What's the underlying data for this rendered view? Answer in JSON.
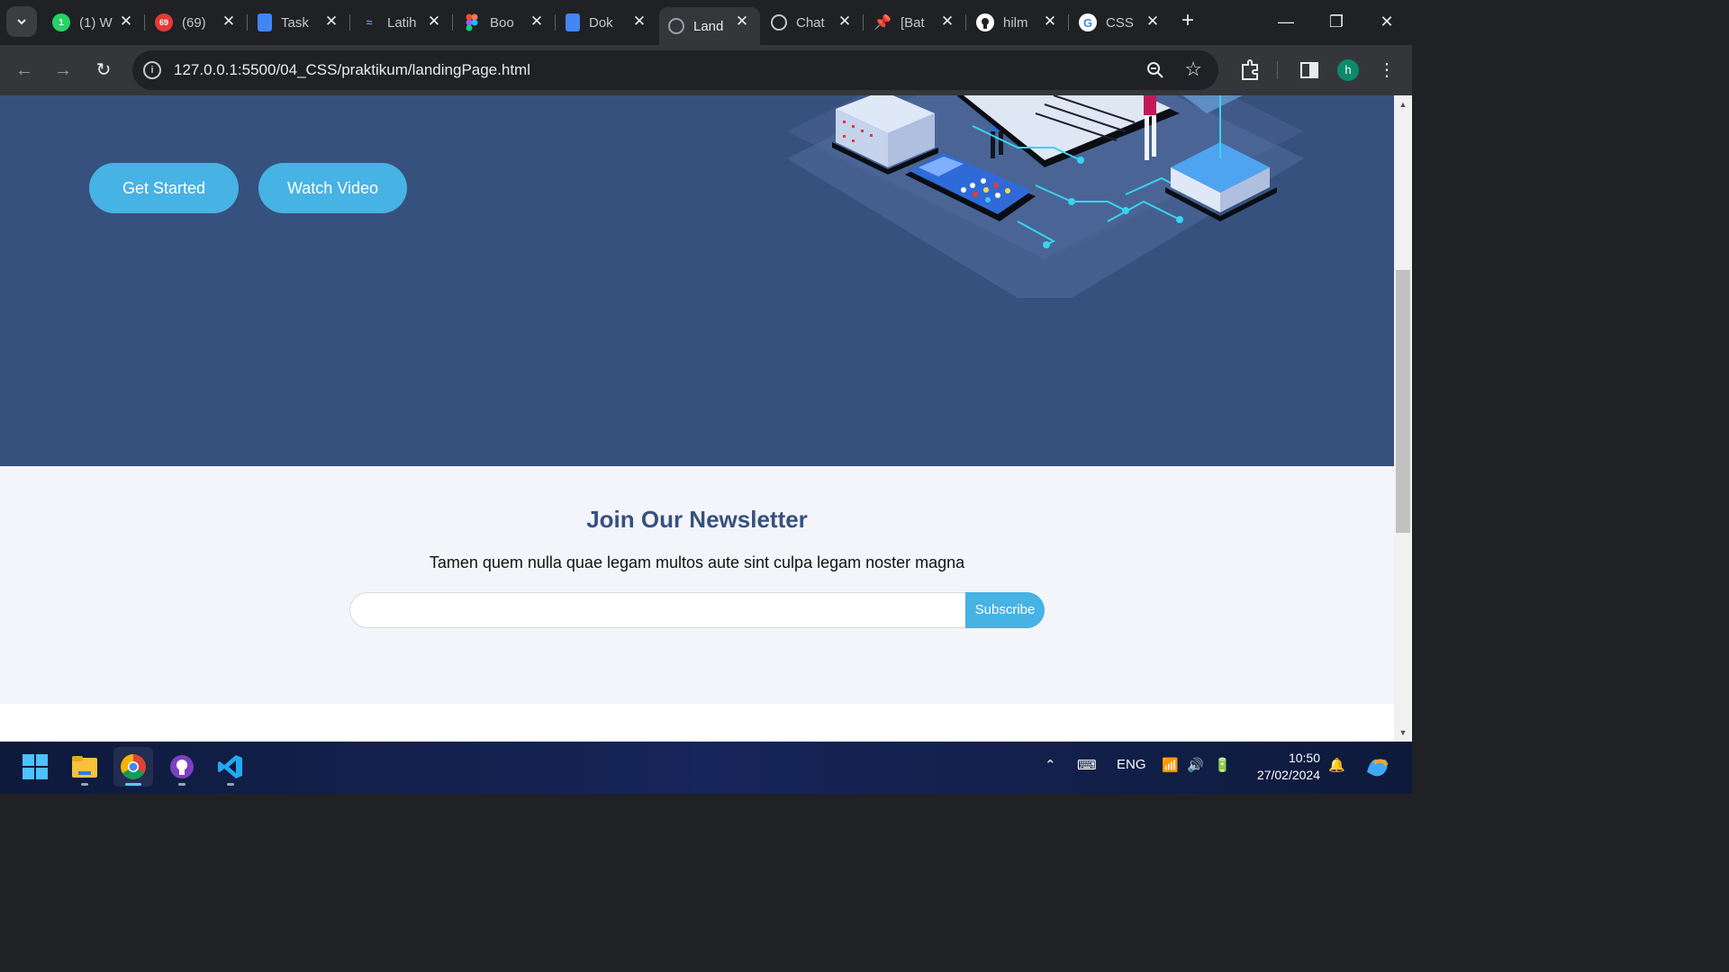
{
  "browser": {
    "tabs": [
      {
        "title": "(1) W",
        "icon": "whatsapp-icon",
        "badge": "1",
        "color": "#25d366"
      },
      {
        "title": "(69)",
        "icon": "chrome-badge-icon",
        "badge": "69",
        "color": "#e53935"
      },
      {
        "title": "Task",
        "icon": "docs-icon",
        "color": "#4285f4"
      },
      {
        "title": "Latih",
        "icon": "latih-icon",
        "color": "#3b5bdb"
      },
      {
        "title": "Boo",
        "icon": "figma-icon",
        "color": "#f24e1e"
      },
      {
        "title": "Dok",
        "icon": "docs-icon",
        "color": "#4285f4"
      },
      {
        "title": "Land",
        "icon": "globe-icon",
        "color": "#9aa0a6",
        "active": true
      },
      {
        "title": "Chat",
        "icon": "chatgpt-icon",
        "color": "#c4c7c5"
      },
      {
        "title": "[Bat",
        "icon": "pin-icon",
        "color": "#e53935"
      },
      {
        "title": "hilm",
        "icon": "github-icon",
        "color": "#ffffff"
      },
      {
        "title": "CSS",
        "icon": "google-icon",
        "color": "#4285f4"
      }
    ],
    "url": "127.0.0.1:5500/04_CSS/praktikum/landingPage.html",
    "profile_initial": "h"
  },
  "page": {
    "hero": {
      "get_started_label": "Get Started",
      "watch_video_label": "Watch Video",
      "bg_color": "#37517e",
      "accent_color": "#47b2e4"
    },
    "newsletter": {
      "title": "Join Our Newsletter",
      "text": "Tamen quem nulla quae legam multos aute sint culpa legam noster magna",
      "email_value": "",
      "subscribe_label": "Subscribe"
    }
  },
  "taskbar": {
    "apps": [
      "windows-start-icon",
      "file-explorer-icon",
      "chrome-icon",
      "github-desktop-icon",
      "vscode-icon"
    ],
    "language": "ENG",
    "time": "10:50",
    "date": "27/02/2024"
  }
}
